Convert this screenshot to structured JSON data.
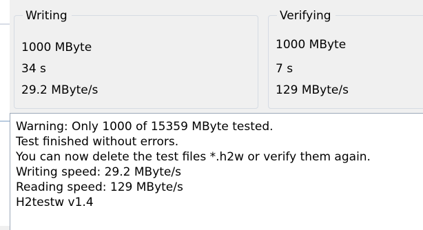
{
  "writing": {
    "title": "Writing",
    "size": "1000 MByte",
    "time": "34 s",
    "speed": "29.2 MByte/s"
  },
  "verifying": {
    "title": "Verifying",
    "size": "1000 MByte",
    "time": "7 s",
    "speed": "129 MByte/s"
  },
  "log": {
    "lines": [
      "Warning: Only 1000 of 15359 MByte tested.",
      "Test finished without errors.",
      "You can now delete the test files *.h2w or verify them again.",
      "Writing speed: 29.2 MByte/s",
      "Reading speed: 129 MByte/s",
      "H2testw v1.4"
    ]
  }
}
